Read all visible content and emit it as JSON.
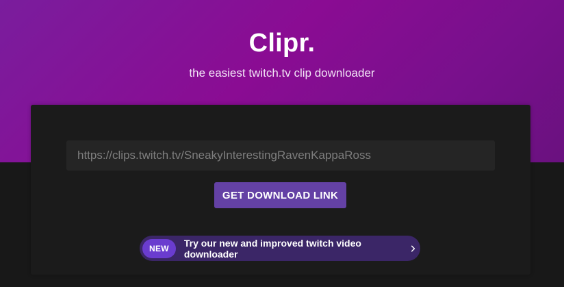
{
  "header": {
    "title": "Clipr.",
    "subtitle": "the easiest twitch.tv clip downloader"
  },
  "form": {
    "url_placeholder": "https://clips.twitch.tv/SneakyInterestingRavenKappaRoss",
    "url_value": "",
    "submit_label": "GET DOWNLOAD LINK"
  },
  "promo": {
    "badge": "NEW",
    "text": "Try our new and improved twitch video downloader",
    "icon": "chevron-right-icon"
  },
  "colors": {
    "brand_purple": "#8a0c93",
    "button": "#6441a5",
    "badge": "#6a3ccf",
    "promo_bg": "#3b2667",
    "background": "#181818"
  }
}
